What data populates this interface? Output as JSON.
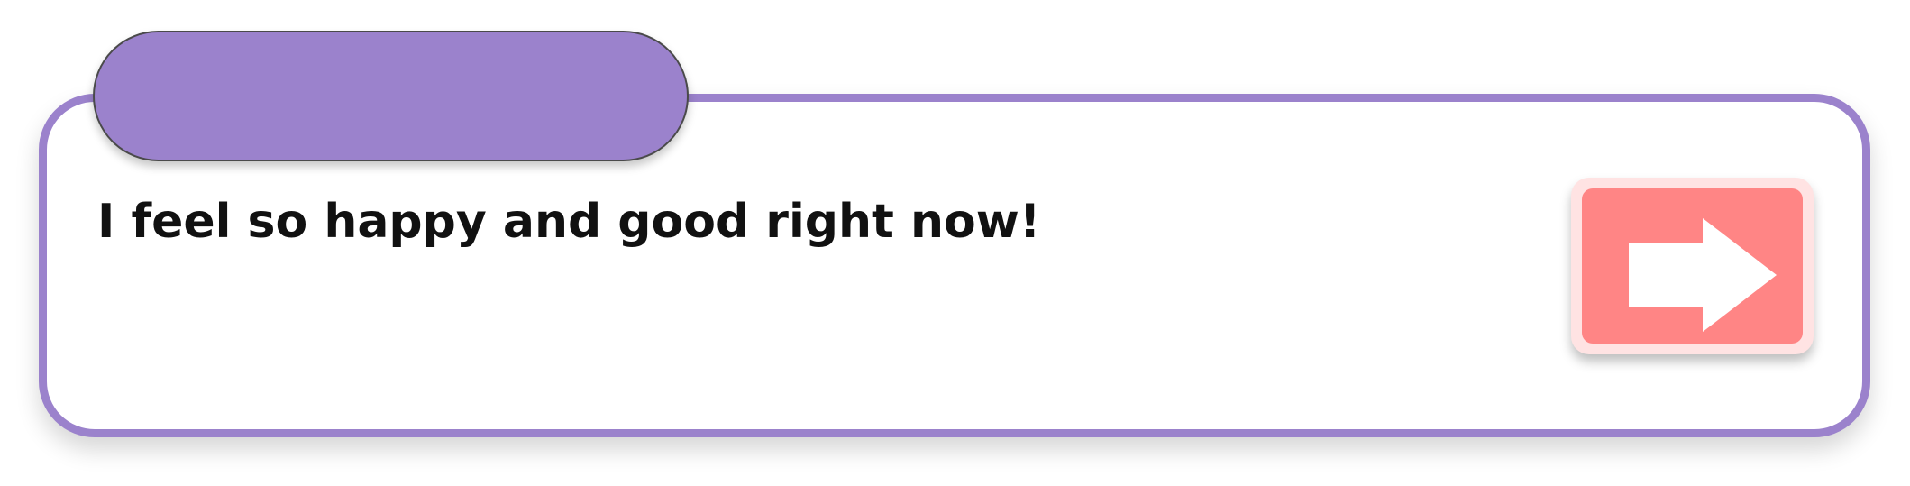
{
  "dialogue": {
    "speaker_name": "",
    "text": "I feel so happy and good right now!"
  },
  "next_button": {
    "icon": "arrow-right-icon"
  },
  "colors": {
    "accent_purple": "#9b82cc",
    "button_red": "#ff8585",
    "button_border": "#ffe3e3",
    "text": "#111111"
  }
}
